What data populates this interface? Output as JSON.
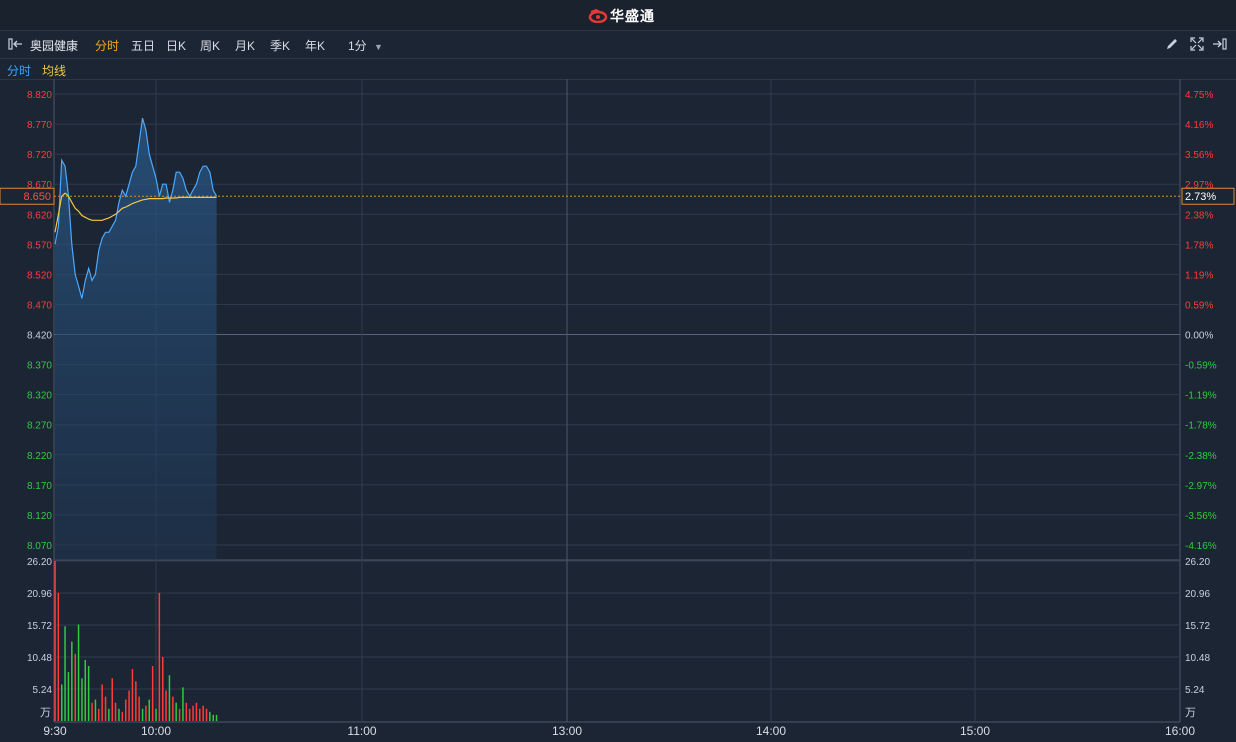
{
  "app": {
    "brand": "华盛通"
  },
  "toolbar": {
    "stock_name": "奥园健康",
    "tabs": [
      {
        "label": "分时",
        "active": true
      },
      {
        "label": "五日",
        "active": false
      },
      {
        "label": "日K",
        "active": false
      },
      {
        "label": "周K",
        "active": false
      },
      {
        "label": "月K",
        "active": false
      },
      {
        "label": "季K",
        "active": false
      },
      {
        "label": "年K",
        "active": false
      }
    ],
    "interval": "1分",
    "icons": [
      "collapse-left-icon",
      "pencil-icon",
      "fullscreen-icon",
      "expand-right-icon"
    ]
  },
  "legend": {
    "price_line": "分时",
    "avg_line": "均线"
  },
  "colors": {
    "background": "#1c2533",
    "grid": "#2e3a4c",
    "up": "#ff3b3b",
    "down": "#2ecc40",
    "price": "#4aa8ff",
    "avg": "#f5c842",
    "accent": "#f5a623"
  },
  "chart_data": {
    "type": "line",
    "prev_close": 8.42,
    "current": {
      "price": "8.650",
      "change_pct": "2.73%"
    },
    "price_axis": {
      "ylim": [
        8.045,
        8.845
      ],
      "ticks": [
        "8.820",
        "8.770",
        "8.720",
        "8.670",
        "8.620",
        "8.570",
        "8.520",
        "8.470",
        "8.420",
        "8.370",
        "8.320",
        "8.270",
        "8.220",
        "8.170",
        "8.120",
        "8.070"
      ],
      "pct_ticks": [
        "4.75%",
        "4.16%",
        "3.56%",
        "2.97%",
        "2.38%",
        "1.78%",
        "1.19%",
        "0.59%",
        "0.00%",
        "-0.59%",
        "-1.19%",
        "-1.78%",
        "-2.38%",
        "-2.97%",
        "-3.56%",
        "-4.16%"
      ]
    },
    "x_axis": {
      "ticks": [
        "9:30",
        "10:00",
        "11:00",
        "13:00",
        "14:00",
        "15:00",
        "16:00"
      ]
    },
    "price_series": [
      8.57,
      8.6,
      8.71,
      8.7,
      8.65,
      8.57,
      8.52,
      8.5,
      8.48,
      8.51,
      8.53,
      8.51,
      8.52,
      8.56,
      8.58,
      8.59,
      8.59,
      8.6,
      8.61,
      8.64,
      8.66,
      8.65,
      8.67,
      8.69,
      8.7,
      8.74,
      8.78,
      8.76,
      8.72,
      8.7,
      8.68,
      8.65,
      8.67,
      8.67,
      8.64,
      8.66,
      8.69,
      8.69,
      8.68,
      8.66,
      8.65,
      8.66,
      8.67,
      8.69,
      8.7,
      8.7,
      8.69,
      8.66,
      8.65
    ],
    "avg_series": [
      8.59,
      8.62,
      8.65,
      8.655,
      8.65,
      8.64,
      8.63,
      8.625,
      8.618,
      8.615,
      8.612,
      8.61,
      8.61,
      8.61,
      8.61,
      8.612,
      8.614,
      8.617,
      8.62,
      8.625,
      8.63,
      8.632,
      8.635,
      8.638,
      8.64,
      8.642,
      8.644,
      8.645,
      8.646,
      8.646,
      8.646,
      8.646,
      8.646,
      8.647,
      8.647,
      8.647,
      8.647,
      8.648,
      8.648,
      8.648,
      8.648,
      8.648,
      8.648,
      8.648,
      8.648,
      8.648,
      8.648,
      8.648,
      8.648
    ],
    "volume_axis": {
      "ylim": [
        0,
        26.2
      ],
      "ticks": [
        "26.20",
        "20.96",
        "15.72",
        "10.48",
        "5.24"
      ],
      "unit": "万"
    },
    "volume_series": [
      26.2,
      21.0,
      6.0,
      15.5,
      8.0,
      13.0,
      11.0,
      15.8,
      7.0,
      10.0,
      9.0,
      3.0,
      3.5,
      2.0,
      6.0,
      4.0,
      2.0,
      7.0,
      3.0,
      2.0,
      1.5,
      3.5,
      5.0,
      8.5,
      6.5,
      4.0,
      2.0,
      2.5,
      3.5,
      9.0,
      2.0,
      21.0,
      10.5,
      5.0,
      7.5,
      4.0,
      3.0,
      2.0,
      5.5,
      3.0,
      2.0,
      2.5,
      3.0,
      2.0,
      2.5,
      2.0,
      1.5,
      1.0,
      1.0
    ],
    "volume_direction": [
      "u",
      "u",
      "d",
      "d",
      "d",
      "d",
      "u",
      "d",
      "d",
      "d",
      "d",
      "u",
      "d",
      "u",
      "u",
      "u",
      "d",
      "u",
      "u",
      "d",
      "u",
      "u",
      "u",
      "u",
      "u",
      "u",
      "d",
      "u",
      "d",
      "u",
      "d",
      "u",
      "u",
      "u",
      "d",
      "u",
      "d",
      "u",
      "d",
      "u",
      "u",
      "u",
      "u",
      "u",
      "u",
      "u",
      "d",
      "d",
      "d"
    ]
  }
}
